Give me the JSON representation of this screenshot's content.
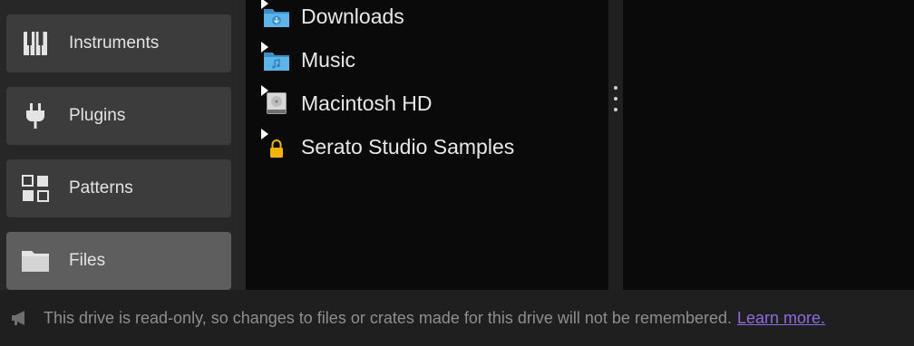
{
  "sidebar": {
    "items": [
      {
        "label": "Instruments",
        "icon": "piano-icon"
      },
      {
        "label": "Plugins",
        "icon": "plug-icon"
      },
      {
        "label": "Patterns",
        "icon": "grid-icon"
      },
      {
        "label": "Files",
        "icon": "folder-icon",
        "active": true
      }
    ]
  },
  "browser": {
    "items": [
      {
        "label": "Downloads",
        "icon": "downloads-folder-icon"
      },
      {
        "label": "Music",
        "icon": "music-folder-icon"
      },
      {
        "label": "Macintosh HD",
        "icon": "hard-drive-icon"
      },
      {
        "label": "Serato Studio Samples",
        "icon": "lock-icon"
      }
    ]
  },
  "footer": {
    "message": "This drive is read-only, so changes to files or crates made for this drive will not be remembered.",
    "link": "Learn more."
  },
  "colors": {
    "active_item": "#5e5e5e",
    "link": "#8a6de0",
    "folder_blue": "#4aa6dc",
    "lock_yellow": "#f2b400"
  }
}
